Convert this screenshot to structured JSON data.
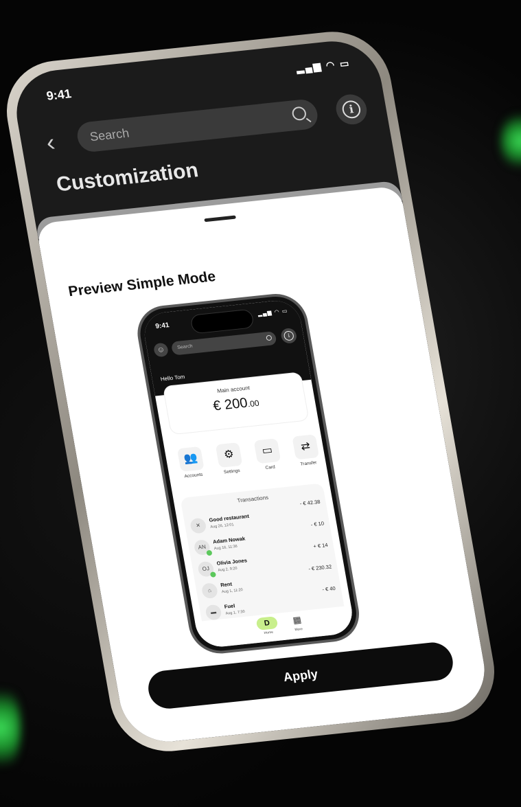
{
  "status": {
    "time": "9:41",
    "signal_icons": "signal wifi battery"
  },
  "topbar": {
    "search_placeholder": "Search",
    "back_icon": "chevron-left-icon",
    "info_icon": "info-icon"
  },
  "page": {
    "title": "Customization"
  },
  "sheet": {
    "preview_title": "Preview Simple Mode",
    "apply_label": "Apply"
  },
  "preview_phone": {
    "time": "9:41",
    "search_placeholder": "Search",
    "greeting": "Hello Tom",
    "account": {
      "label": "Main account",
      "amount_main": "€ 200",
      "amount_cents": ".00"
    },
    "actions": [
      {
        "label": "Accounts",
        "icon": "users-icon"
      },
      {
        "label": "Settings",
        "icon": "gear-icon"
      },
      {
        "label": "Card",
        "icon": "card-icon"
      },
      {
        "label": "Transfer",
        "icon": "transfer-icon"
      }
    ],
    "transactions_header": "Transactions",
    "transactions": [
      {
        "name": "Good restaurant",
        "date": "Aug 26, 12:01",
        "amount": "- € 42.38",
        "icon": "utensils-icon",
        "initials": ""
      },
      {
        "name": "Adam Nowak",
        "date": "Aug 16, 11:36",
        "amount": "- € 10",
        "icon": "avatar-initials",
        "initials": "AN"
      },
      {
        "name": "Olivia Jones",
        "date": "Aug 2, 9:20",
        "amount": "+ € 14",
        "icon": "avatar-initials",
        "initials": "OJ"
      },
      {
        "name": "Rent",
        "date": "Aug 1, 11:20",
        "amount": "- € 230.32",
        "icon": "home-icon",
        "initials": ""
      },
      {
        "name": "Fuel",
        "date": "Aug 1, 7:30",
        "amount": "- € 40",
        "icon": "car-icon",
        "initials": ""
      }
    ],
    "nav": {
      "home_label": "Home",
      "more_label": "More"
    }
  },
  "colors": {
    "accent": "#c8ef8c",
    "glow": "#3ee05a",
    "dark": "#0c0c0c"
  }
}
